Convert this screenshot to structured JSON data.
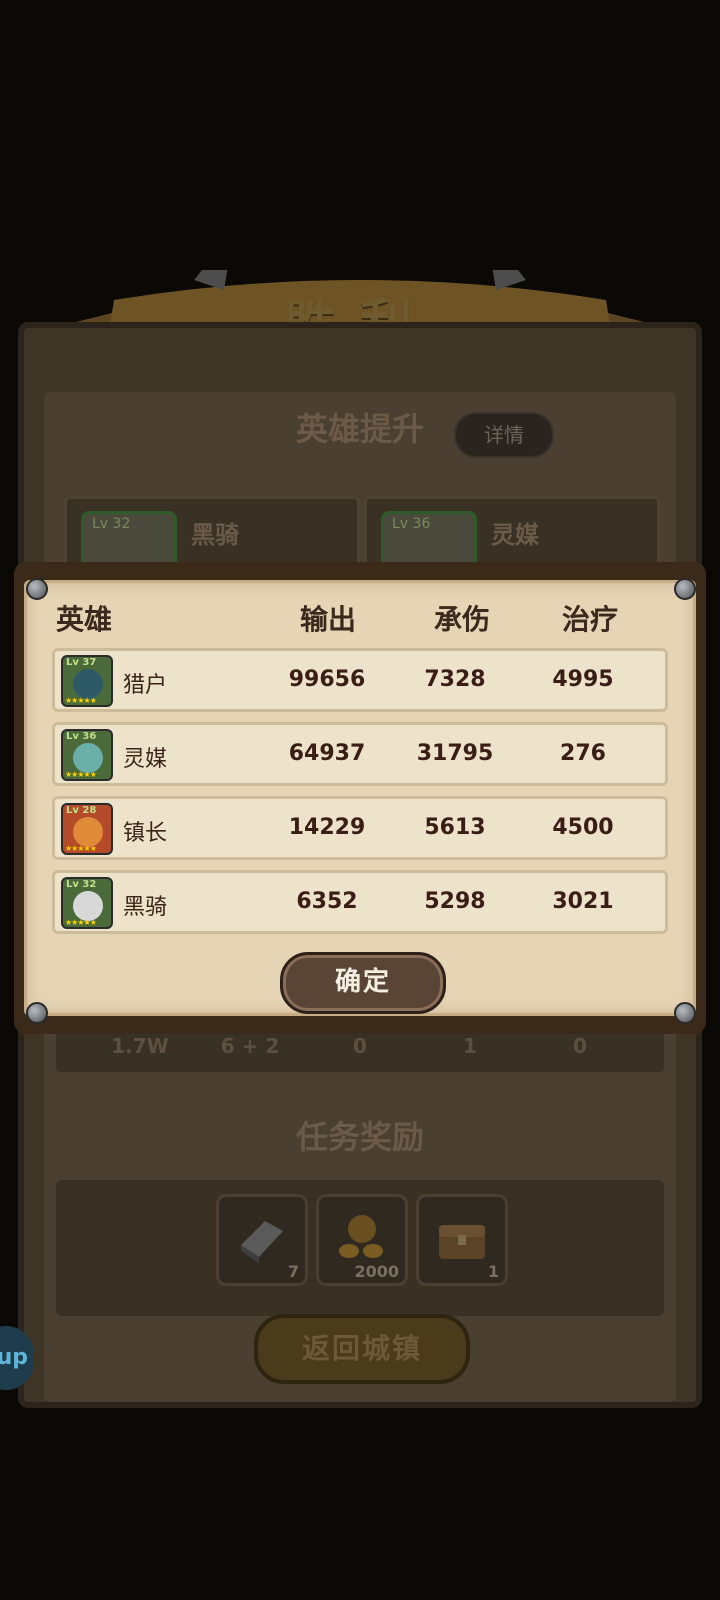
{
  "background": {
    "title": "胜利",
    "hero_upgrade_label": "英雄提升",
    "detail_button_label": "详情",
    "hero_cards": [
      {
        "level": "Lv 32",
        "name": "黑骑"
      },
      {
        "level": "Lv 36",
        "name": "灵媒"
      }
    ],
    "stats_values": [
      "1.7W",
      "6 + 2",
      "0",
      "1",
      "0"
    ],
    "task_reward_label": "任务奖励",
    "rewards": [
      {
        "icon": "iron-ingot-icon",
        "count": "7"
      },
      {
        "icon": "gold-coins-icon",
        "count": "2000"
      },
      {
        "icon": "treasure-chest-icon",
        "count": "1"
      }
    ],
    "return_button_label": "返回城镇",
    "side_bubble_text": "up"
  },
  "modal": {
    "headers": {
      "hero": "英雄",
      "damage": "输出",
      "tank": "承伤",
      "heal": "治疗"
    },
    "rows": [
      {
        "name": "猎户",
        "level": "Lv 37",
        "damage": "99656",
        "tank": "7328",
        "heal": "4995",
        "frame_color": "#4b6a3a",
        "face_color": "#2e5a68"
      },
      {
        "name": "灵媒",
        "level": "Lv 36",
        "damage": "64937",
        "tank": "31795",
        "heal": "276",
        "frame_color": "#4b6a3a",
        "face_color": "#6ab0a8"
      },
      {
        "name": "镇长",
        "level": "Lv 28",
        "damage": "14229",
        "tank": "5613",
        "heal": "4500",
        "frame_color": "#b34a2a",
        "face_color": "#e08a3a"
      },
      {
        "name": "黑骑",
        "level": "Lv 32",
        "damage": "6352",
        "tank": "5298",
        "heal": "3021",
        "frame_color": "#4b6a3a",
        "face_color": "#d8d8d8"
      }
    ],
    "confirm_label": "确定"
  }
}
